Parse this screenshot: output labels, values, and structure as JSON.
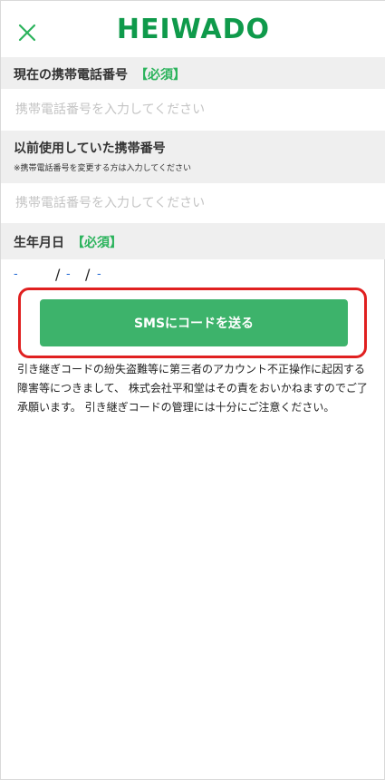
{
  "header": {
    "logo_text": "HEIWADO",
    "close_icon": "close-icon",
    "brand_color": "#0f9a4b"
  },
  "current_phone": {
    "label": "現在の携帯電話番号",
    "required": "【必須】",
    "placeholder": "携帯電話番号を入力してください",
    "value": ""
  },
  "previous_phone": {
    "label": "以前使用していた携帯番号",
    "note": "※携帯電話番号を変更する方は入力してください",
    "placeholder": "携帯電話番号を入力してください",
    "value": ""
  },
  "birthdate": {
    "label": "生年月日",
    "required": "【必須】",
    "year": "-",
    "month": "-",
    "day": "-",
    "separator": "/"
  },
  "sms_button": {
    "label": "SMSにコードを送る",
    "color": "#3db36b"
  },
  "notice": "引き継ぎコードの紛失盗難等に第三者のアカウント不正操作に起因する障害等につきまして、 株式会社平和堂はその責をおいかねますのでご了承願います。 引き継ぎコードの管理には十分にご注意ください。",
  "accent_color": "#2bb35c",
  "highlight_color": "#e02020"
}
